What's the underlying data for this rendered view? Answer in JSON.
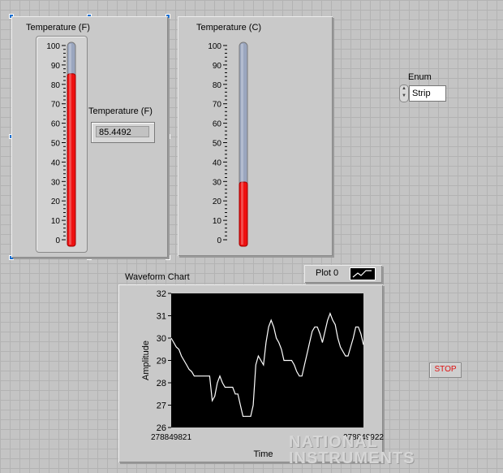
{
  "thermo_f": {
    "title": "Temperature (F)",
    "scale": [
      "100",
      "90",
      "80",
      "70",
      "60",
      "50",
      "40",
      "30",
      "20",
      "10",
      "0"
    ],
    "level": 85.4492,
    "max": 100
  },
  "indicator_f": {
    "label": "Temperature (F)",
    "value": "85.4492"
  },
  "thermo_c": {
    "title": "Temperature (C)",
    "scale": [
      "100",
      "90",
      "80",
      "70",
      "60",
      "50",
      "40",
      "30",
      "20",
      "10",
      "0"
    ],
    "level": 29.7,
    "max": 100
  },
  "enum": {
    "label": "Enum",
    "value": "Strip"
  },
  "plot_legend": {
    "label": "Plot 0"
  },
  "stop": {
    "label": "STOP"
  },
  "logo": {
    "line1": "NATIONAL",
    "line2": "INSTRUMENTS"
  },
  "colors": {
    "fill": "#ee1111",
    "plot_bg": "#000000",
    "trace": "#ffffff",
    "tube": "#9aa6bf"
  },
  "chart_data": {
    "type": "line",
    "title": "Waveform Chart",
    "xlabel": "Time",
    "ylabel": "Amplitude",
    "x_tick_labels": [
      "278849821",
      "278849922"
    ],
    "y_tick_labels": [
      "32",
      "31",
      "30",
      "29",
      "28",
      "27",
      "26"
    ],
    "ylim": [
      26,
      32
    ],
    "grid": false,
    "series": [
      {
        "name": "Plot 0",
        "values": [
          30,
          29.8,
          29.6,
          29.5,
          29.2,
          29,
          28.8,
          28.6,
          28.5,
          28.3,
          28.3,
          28.3,
          28.3,
          28.3,
          28.3,
          28.3,
          27.2,
          27.4,
          28,
          28.3,
          28,
          27.8,
          27.8,
          27.8,
          27.8,
          27.5,
          27.5,
          27,
          26.5,
          26.5,
          26.5,
          26.5,
          27,
          28.8,
          29.2,
          29,
          28.8,
          29.8,
          30.5,
          30.8,
          30.5,
          30,
          29.8,
          29.5,
          29,
          29,
          29,
          29,
          28.8,
          28.5,
          28.3,
          28.3,
          28.8,
          29.3,
          29.8,
          30.3,
          30.5,
          30.5,
          30.2,
          29.8,
          30.3,
          30.8,
          31.1,
          30.8,
          30.6,
          30,
          29.6,
          29.4,
          29.2,
          29.2,
          29.6,
          30,
          30.5,
          30.5,
          30.2,
          29.7
        ]
      }
    ]
  }
}
